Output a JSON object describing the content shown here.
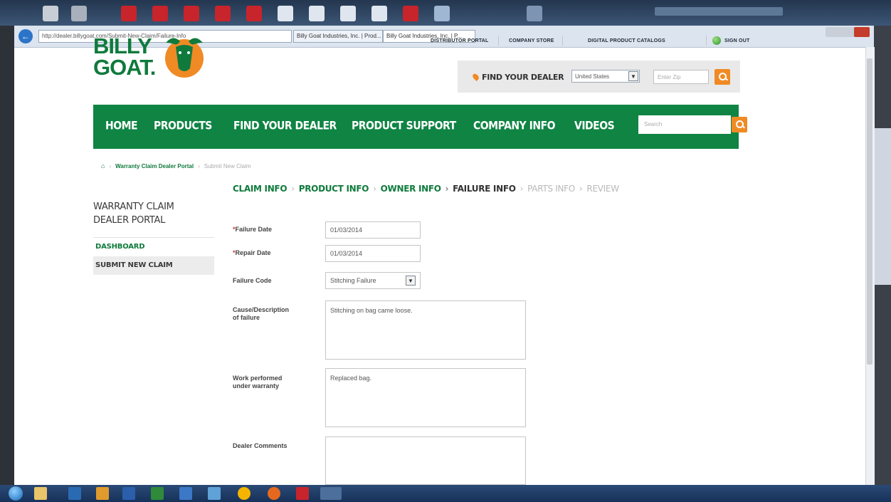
{
  "browser": {
    "address": "http://dealer.billygoat.com/Submit-New-Claim/Failure-Info",
    "tabs": [
      "Billy Goat Industries, Inc. | Prod...",
      "Billy Goat Industries, Inc. | P..."
    ]
  },
  "header": {
    "logo_text": "BILLY GOAT.",
    "top_links": [
      "DISTRIBUTOR PORTAL",
      "COMPANY STORE",
      "DIGITAL PRODUCT CATALOGS"
    ],
    "sign_out": "SIGN OUT",
    "dealer": {
      "label": "FIND YOUR DEALER",
      "country": "United States",
      "zip_placeholder": "Enter Zip"
    }
  },
  "mainnav": {
    "items": [
      "HOME",
      "PRODUCTS",
      "FIND YOUR DEALER",
      "PRODUCT SUPPORT",
      "COMPANY INFO",
      "VIDEOS"
    ],
    "search_placeholder": "Search"
  },
  "breadcrumb": {
    "home_icon": "home-icon",
    "link": "Warranty Claim Dealer Portal",
    "current": "Submit New Claim"
  },
  "steps": {
    "claim": "CLAIM INFO",
    "product": "PRODUCT INFO",
    "owner": "OWNER INFO",
    "failure": "FAILURE INFO",
    "parts": "PARTS INFO",
    "review": "REVIEW"
  },
  "sidebar": {
    "title_line1": "WARRANTY CLAIM",
    "title_line2": "DEALER PORTAL",
    "items": [
      "DASHBOARD",
      "SUBMIT NEW CLAIM"
    ]
  },
  "form": {
    "failure_date": {
      "label": "Failure Date",
      "value": "01/03/2014"
    },
    "repair_date": {
      "label": "Repair Date",
      "value": "01/03/2014"
    },
    "failure_code": {
      "label": "Failure Code",
      "value": "Stitching Failure"
    },
    "cause": {
      "label_line1": "Cause/Description",
      "label_line2": "of failure",
      "value": "Stitching on bag came loose."
    },
    "work": {
      "label_line1": "Work performed",
      "label_line2": "under warranty",
      "value": "Replaced bag."
    },
    "dealer_comments": {
      "label": "Dealer Comments",
      "value": ""
    }
  },
  "colors": {
    "brand_green": "#0f8443",
    "accent_orange": "#f08a24"
  }
}
